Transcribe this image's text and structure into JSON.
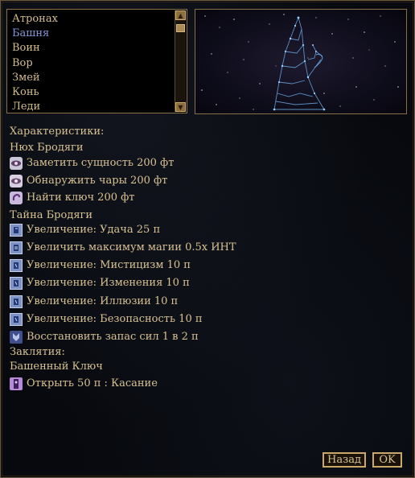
{
  "signs": {
    "items": [
      "Атронах",
      "Башня",
      "Воин",
      "Вор",
      "Змей",
      "Конь",
      "Леди"
    ],
    "selected_index": 1
  },
  "details": {
    "characteristics_label": "Характеристики:",
    "power_title": "Нюх Бродяги",
    "power_effects": [
      {
        "icon": "detect-creature-icon",
        "label": "Заметить сущность 200 фт"
      },
      {
        "icon": "detect-enchantment-icon",
        "label": "Обнаружить чары 200 фт"
      },
      {
        "icon": "detect-key-icon",
        "label": "Найти ключ 200 фт"
      }
    ],
    "ability_title": "Тайна Бродяги",
    "ability_effects": [
      {
        "icon": "fortify-attribute-icon",
        "label": "Увеличение: Удача 25 п"
      },
      {
        "icon": "fortify-magicka-icon",
        "label": "Увеличить максимум магии 0.5х ИНТ"
      },
      {
        "icon": "fortify-skill-icon",
        "label": "Увеличение: Мистицизм 10 п"
      },
      {
        "icon": "fortify-skill-icon",
        "label": "Увеличение: Изменения 10 п"
      },
      {
        "icon": "fortify-skill-icon",
        "label": "Увеличение: Иллюзии 10 п"
      },
      {
        "icon": "fortify-skill-icon",
        "label": "Увеличение: Безопасность 10 п"
      },
      {
        "icon": "restore-fatigue-icon",
        "label": "Восстановить запас сил 1 в 2 п"
      }
    ],
    "spells_label": "Заклятия:",
    "spell_title": "Башенный Ключ",
    "spell_effects": [
      {
        "icon": "open-lock-icon",
        "label": "Открыть 50 п : Касание"
      }
    ]
  },
  "buttons": {
    "back": "Назад",
    "ok": "OK"
  },
  "colors": {
    "text": "#d8c294",
    "selected": "#8794d6",
    "border": "#8a7048"
  }
}
